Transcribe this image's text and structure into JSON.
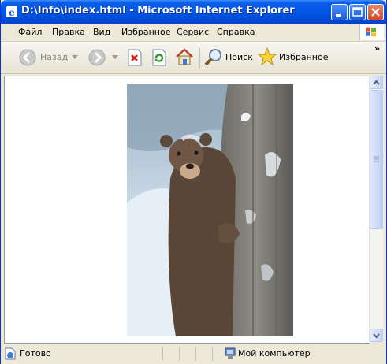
{
  "window": {
    "title": "D:\\Info\\index.html - Microsoft Internet Explorer"
  },
  "menu": {
    "items": [
      {
        "label": "Файл"
      },
      {
        "label": "Правка"
      },
      {
        "label": "Вид"
      },
      {
        "label": "Избранное"
      },
      {
        "label": "Сервис"
      },
      {
        "label": "Справка"
      }
    ]
  },
  "toolbar": {
    "back_label": "Назад",
    "search_label": "Поиск",
    "favorites_label": "Избранное",
    "overflow": "»"
  },
  "content": {
    "image_subject": "bear-behind-tree-photo"
  },
  "status": {
    "text": "Готово",
    "zone": "Мой компьютер"
  },
  "colors": {
    "titlebar": "#0354e4",
    "chrome": "#ece9d8",
    "close_button": "#d14a20"
  }
}
